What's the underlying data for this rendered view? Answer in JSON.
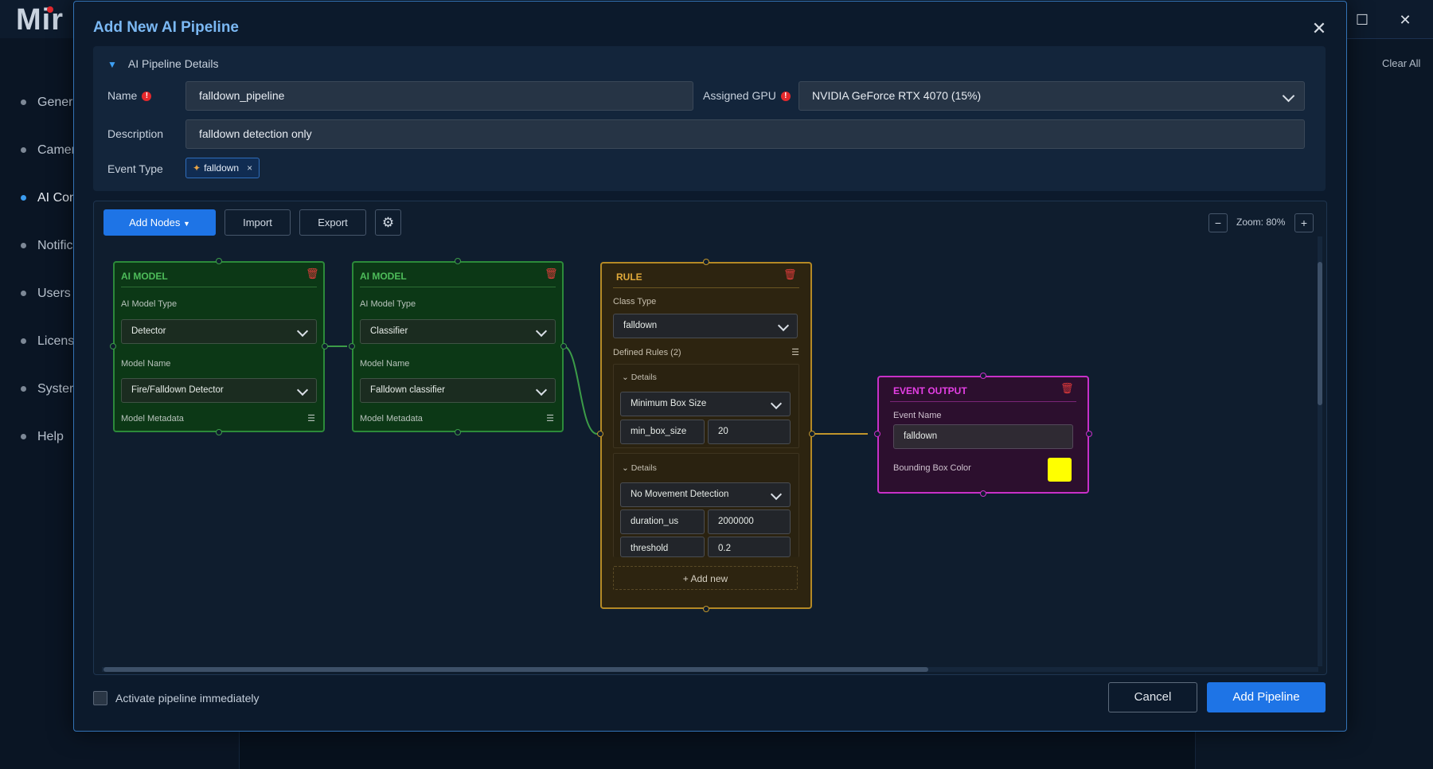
{
  "background": {
    "logo": "Mir",
    "nav_items": [
      {
        "label": "Genera",
        "active": false
      },
      {
        "label": "Camer",
        "active": false
      },
      {
        "label": "AI Con",
        "active": true
      },
      {
        "label": "Notific",
        "active": false
      },
      {
        "label": "Users",
        "active": false
      },
      {
        "label": "Licens",
        "active": false
      },
      {
        "label": "Syster",
        "active": false
      },
      {
        "label": "Help",
        "active": false
      }
    ],
    "clear_all": "Clear All",
    "window_maximize_icon": "maximize-icon",
    "window_close_icon": "close-icon"
  },
  "modal": {
    "title": "Add New AI Pipeline",
    "details": {
      "section_title": "AI Pipeline Details",
      "name_label": "Name",
      "name_value": "falldown_pipeline",
      "gpu_label": "Assigned GPU",
      "gpu_value": "NVIDIA GeForce RTX 4070 (15%)",
      "description_label": "Description",
      "description_value": "falldown detection only",
      "event_type_label": "Event Type",
      "event_tag": "falldown"
    },
    "toolbar": {
      "add_nodes": "Add Nodes",
      "import": "Import",
      "export": "Export",
      "zoom_label": "Zoom: 80%",
      "zoom_minus": "−",
      "zoom_plus": "+"
    },
    "nodes": {
      "model1": {
        "title": "AI MODEL",
        "type_label": "AI Model Type",
        "type_value": "Detector",
        "name_label": "Model Name",
        "name_value": "Fire/Falldown Detector",
        "metadata_label": "Model Metadata"
      },
      "model2": {
        "title": "AI MODEL",
        "type_label": "AI Model Type",
        "type_value": "Classifier",
        "name_label": "Model Name",
        "name_value": "Falldown classifier",
        "metadata_label": "Model Metadata"
      },
      "rule": {
        "title": "RULE",
        "class_type_label": "Class Type",
        "class_type_value": "falldown",
        "defined_rules_label": "Defined Rules (2)",
        "rules": [
          {
            "details_label": "Details",
            "rule_type": "Minimum Box Size",
            "params": [
              {
                "key": "min_box_size",
                "value": "20"
              }
            ]
          },
          {
            "details_label": "Details",
            "rule_type": "No Movement Detection",
            "params": [
              {
                "key": "duration_us",
                "value": "2000000"
              },
              {
                "key": "threshold",
                "value": "0.2"
              }
            ]
          }
        ],
        "add_new": "+ Add new"
      },
      "event": {
        "title": "EVENT OUTPUT",
        "event_name_label": "Event Name",
        "event_name_value": "falldown",
        "bbox_color_label": "Bounding Box Color",
        "bbox_color": "#ffff00"
      }
    },
    "footer": {
      "activate_label": "Activate pipeline immediately",
      "cancel": "Cancel",
      "add_pipeline": "Add Pipeline"
    }
  },
  "colors": {
    "accent": "#1e74e6",
    "ai_model_border": "#2c8a3a",
    "rule_border": "#b48925",
    "event_border": "#c830c8",
    "title_blue": "#7bb8f3"
  }
}
